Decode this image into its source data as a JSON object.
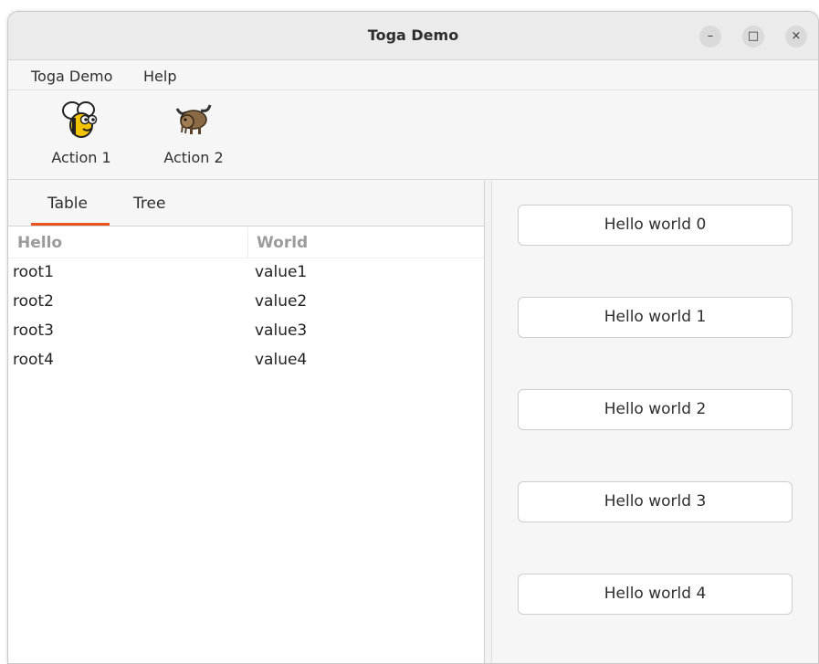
{
  "window": {
    "title": "Toga Demo",
    "controls": {
      "minimize": "–",
      "maximize": "□",
      "close": "×"
    }
  },
  "menubar": {
    "items": [
      {
        "label": "Toga Demo"
      },
      {
        "label": "Help"
      }
    ]
  },
  "toolbar": {
    "actions": [
      {
        "label": "Action 1",
        "icon": "bee-icon"
      },
      {
        "label": "Action 2",
        "icon": "yak-icon"
      }
    ]
  },
  "tabs": {
    "items": [
      {
        "label": "Table",
        "selected": true
      },
      {
        "label": "Tree",
        "selected": false
      }
    ]
  },
  "table": {
    "columns": [
      "Hello",
      "World"
    ],
    "rows": [
      [
        "root1",
        "value1"
      ],
      [
        "root2",
        "value2"
      ],
      [
        "root3",
        "value3"
      ],
      [
        "root4",
        "value4"
      ]
    ]
  },
  "buttons": [
    {
      "label": "Hello world 0"
    },
    {
      "label": "Hello world 1"
    },
    {
      "label": "Hello world 2"
    },
    {
      "label": "Hello world 3"
    },
    {
      "label": "Hello world 4"
    }
  ],
  "colors": {
    "accent": "#e95420",
    "window_bg": "#f6f6f6",
    "header_text": "#9b9b9b"
  }
}
